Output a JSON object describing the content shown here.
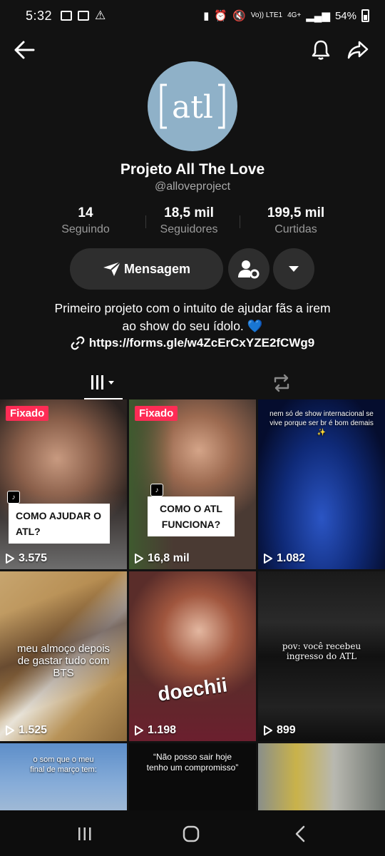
{
  "status_bar": {
    "time": "5:32",
    "network": "Vo)) LTE1",
    "network_type": "4G+",
    "battery": "54%"
  },
  "profile": {
    "avatar_logo": "atl",
    "name": "Projeto All The Love",
    "handle": "@alloveproject",
    "stats": [
      {
        "value": "14",
        "label": "Seguindo"
      },
      {
        "value": "18,5 mil",
        "label": "Seguidores"
      },
      {
        "value": "199,5 mil",
        "label": "Curtidas"
      }
    ],
    "message_button": "Mensagem",
    "bio_line1": "Primeiro projeto com o intuito de ajudar fãs a irem",
    "bio_line2": "ao show do seu ídolo. 💙",
    "link": "https://forms.gle/w4ZcErCxYZE2fCWg9"
  },
  "videos": [
    {
      "pinned": "Fixado",
      "caption": "COMO AJUDAR O ATL?",
      "views": "3.575"
    },
    {
      "pinned": "Fixado",
      "caption": "COMO O ATL FUNCIONA?",
      "views": "16,8 mil"
    },
    {
      "overlay": "nem só de show internacional se vive porque ser br é bom demais ✨",
      "views": "1.082"
    },
    {
      "overlay": "meu almoço depois de gastar tudo com BTS",
      "views": "1.525"
    },
    {
      "overlay": "doechii",
      "views": "1.198"
    },
    {
      "overlay": "pov: você recebeu ingresso do ATL",
      "views": "899"
    },
    {
      "overlay": "o som que o meu final de março tem:"
    },
    {
      "overlay": "“Não posso sair hoje tenho um compromisso”"
    },
    {
      "overlay": ""
    }
  ],
  "colors": {
    "background": "#121212",
    "pinned_badge": "#fe2c55",
    "button": "#2e2e2e",
    "avatar": "#8fb1c8"
  }
}
